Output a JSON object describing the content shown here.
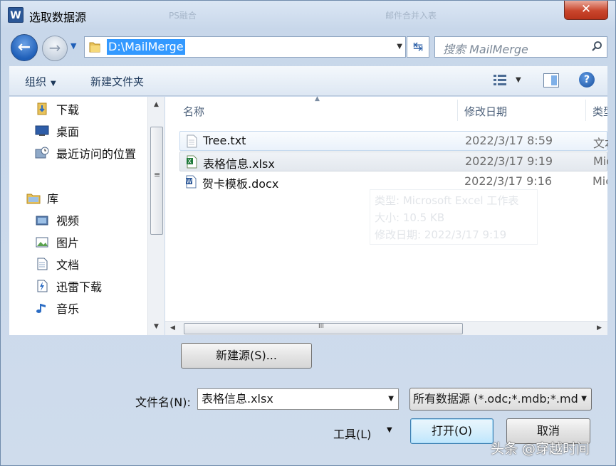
{
  "titlebar": {
    "title": "选取数据源",
    "app_icon_letter": "W",
    "close_glyph": "✕",
    "blur_tab_1": "PS融合",
    "blur_tab_2": "邮件合并入表"
  },
  "nav": {
    "back": "←",
    "forward": "→",
    "refresh": "↹"
  },
  "address": {
    "path": "D:\\MailMerge"
  },
  "search": {
    "placeholder": "搜索 MailMerge"
  },
  "toolbar": {
    "organize": "组织",
    "new_folder": "新建文件夹"
  },
  "sidebar": {
    "items": [
      {
        "label": "下载",
        "icon": "download-folder-icon"
      },
      {
        "label": "桌面",
        "icon": "desktop-icon"
      },
      {
        "label": "最近访问的位置",
        "icon": "recent-places-icon"
      },
      {
        "label": "库",
        "icon": "library-icon"
      },
      {
        "label": "视频",
        "icon": "videos-library-icon"
      },
      {
        "label": "图片",
        "icon": "pictures-library-icon"
      },
      {
        "label": "文档",
        "icon": "documents-library-icon"
      },
      {
        "label": "迅雷下载",
        "icon": "thunder-download-icon"
      },
      {
        "label": "音乐",
        "icon": "music-library-icon"
      }
    ]
  },
  "filelist": {
    "columns": {
      "name": "名称",
      "modified": "修改日期",
      "type": "类型"
    },
    "rows": [
      {
        "name": "Tree.txt",
        "date": "2022/3/17 8:59",
        "type": "文本文档",
        "icon": "text-file-icon"
      },
      {
        "name": "表格信息.xlsx",
        "date": "2022/3/17 9:19",
        "type": "Microsoft Excel",
        "icon": "excel-file-icon"
      },
      {
        "name": "贺卡模板.docx",
        "date": "2022/3/17 9:16",
        "type": "Microsoft Word",
        "icon": "word-file-icon"
      }
    ],
    "tooltip": {
      "line1": "类型: Microsoft Excel 工作表",
      "line2": "大小: 10.5 KB",
      "line3": "修改日期: 2022/3/17 9:19"
    }
  },
  "bottom": {
    "new_source": "新建源(S)...",
    "filename_label": "文件名(N):",
    "filename_value": "表格信息.xlsx",
    "filter_value": "所有数据源 (*.odc;*.mdb;*.mdb",
    "tools": "工具(L)",
    "open": "打开(O)",
    "cancel": "取消"
  },
  "watermark": "头条 @穿越时间"
}
